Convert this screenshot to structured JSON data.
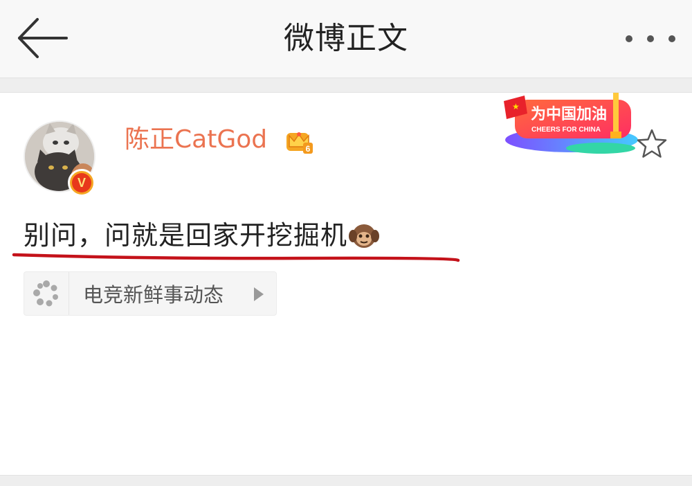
{
  "header": {
    "title": "微博正文",
    "back_icon": "arrow-left-icon",
    "more_icon": "more-horizontal-icon"
  },
  "post": {
    "author": {
      "name": "陈正CatGod",
      "verified_badge_text": "V",
      "vip_level": "6"
    },
    "banner": {
      "text_cn": "为中国加油",
      "text_en": "CHEERS FOR CHINA"
    },
    "favorite_icon": "star-outline-icon",
    "content": "别问，问就是回家开挖掘机",
    "topic": {
      "label": "电竞新鲜事动态",
      "icon": "loading-dots-icon"
    }
  },
  "colors": {
    "username": "#eb7350",
    "underline": "#c4121a",
    "header_bg": "#f8f8f8",
    "separator": "#eeeeee"
  }
}
